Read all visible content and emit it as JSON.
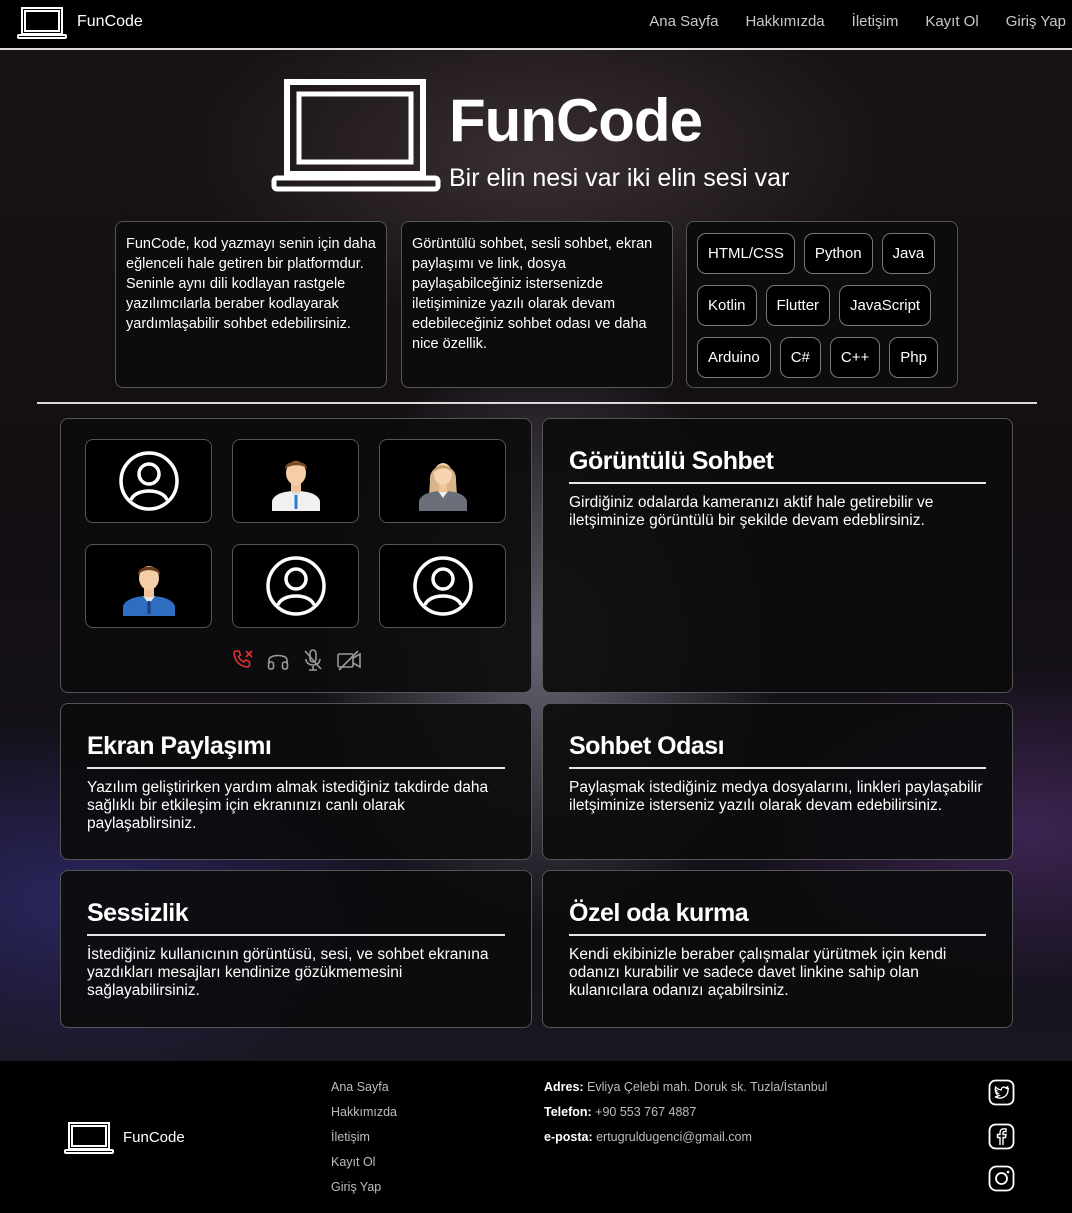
{
  "nav": {
    "brand": "FunCode",
    "links": [
      "Ana Sayfa",
      "Hakkımızda",
      "İletişim",
      "Kayıt Ol",
      "Giriş Yap"
    ]
  },
  "hero": {
    "title": "FunCode",
    "subtitle": "Bir elin nesi var iki elin sesi var"
  },
  "info": {
    "card1": "FunCode, kod yazmayı senin için daha eğlenceli hale getiren bir platformdur. Seninle aynı dili kodlayan rastgele yazılımcılarla beraber kodlayarak yardımlaşabilir sohbet edebilirsiniz.",
    "card2": "Görüntülü sohbet, sesli sohbet, ekran paylaşımı ve link, dosya paylaşabilceğiniz istersenizde iletişiminize yazılı olarak devam edebileceğiniz sohbet odası ve daha nice özellik.",
    "tags": [
      "HTML/CSS",
      "Python",
      "Java",
      "Kotlin",
      "Flutter",
      "JavaScript",
      "Arduino",
      "C#",
      "C++",
      "Php"
    ]
  },
  "features": {
    "video": {
      "title": "Görüntülü Sohbet",
      "desc": "Girdiğiniz odalarda kameranızı aktif hale getirebilir ve iletşiminize görüntülü bir şekilde devam edeblirsiniz.",
      "tiles": [
        "user-outline-icon",
        "man-avatar-icon",
        "woman-avatar-icon",
        "man-avatar-blue-icon",
        "user-outline-icon",
        "user-outline-icon"
      ],
      "controls": [
        "hangup-call-icon",
        "headphones-icon",
        "mic-off-icon",
        "camera-off-icon"
      ]
    },
    "screen": {
      "title": "Ekran Paylaşımı",
      "desc": "Yazılım geliştirirken yardım almak istediğiniz takdirde daha sağlıklı bir etkileşim için ekranınızı canlı olarak paylaşablirsiniz."
    },
    "chat": {
      "title": "Sohbet Odası",
      "desc": "Paylaşmak istediğiniz medya dosyalarını, linkleri paylaşabilir iletşiminize isterseniz yazılı olarak devam edebilirsiniz."
    },
    "silence": {
      "title": "Sessizlik",
      "desc": "İstediğiniz kullanıcının görüntüsü, sesi, ve sohbet ekranına yazdıkları mesajları kendinize gözükmemesini sağlayabilirsiniz."
    },
    "private": {
      "title": "Özel oda kurma",
      "desc": "Kendi ekibinizle beraber çalışmalar yürütmek için kendi odanızı kurabilir ve sadece davet linkine sahip olan kulanıcılara odanızı açabilrsiniz."
    }
  },
  "footer": {
    "brand": "FunCode",
    "links": [
      "Ana Sayfa",
      "Hakkımızda",
      "İletişim",
      "Kayıt Ol",
      "Giriş Yap"
    ],
    "address_label": "Adres:",
    "address": " Evliya Çelebi mah. Doruk sk. Tuzla/İstanbul",
    "phone_label": "Telefon:",
    "phone": " +90 553 767 4887",
    "email_label": "e-posta:",
    "email": " ertugruldugenci@gmail.com",
    "social": [
      "twitter-icon",
      "facebook-icon",
      "instagram-icon"
    ]
  },
  "colors": {
    "background": "#000000",
    "text": "#ffffff",
    "muted": "#bdbdbd",
    "danger": "#e03030"
  }
}
